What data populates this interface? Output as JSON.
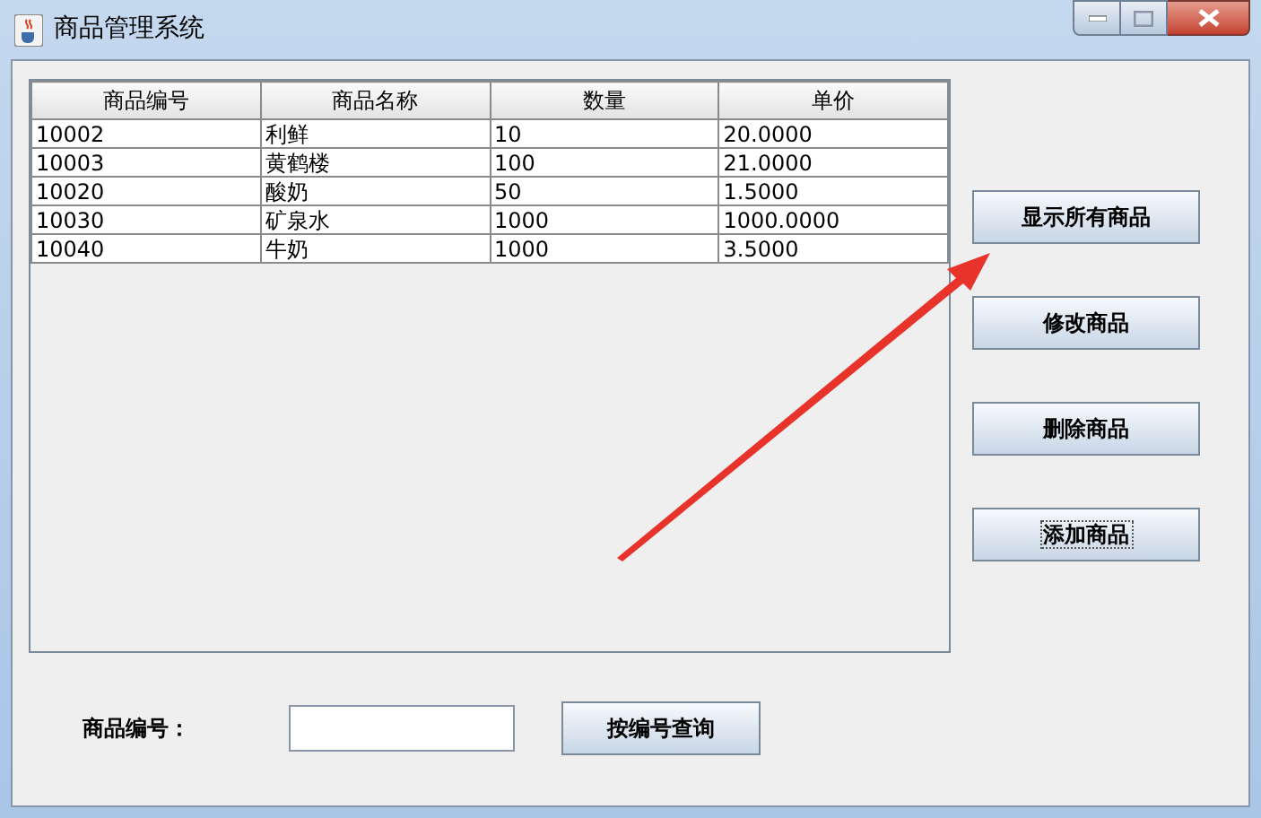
{
  "window": {
    "title": "商品管理系统"
  },
  "table": {
    "columns": [
      "商品编号",
      "商品名称",
      "数量",
      "单价"
    ],
    "rows": [
      [
        "10002",
        "利鲜",
        "10",
        "20.0000"
      ],
      [
        "10003",
        "黄鹤楼",
        "100",
        "21.0000"
      ],
      [
        "10020",
        "酸奶",
        "50",
        "1.5000"
      ],
      [
        "10030",
        "矿泉水",
        "1000",
        "1000.0000"
      ],
      [
        "10040",
        "牛奶",
        "1000",
        "3.5000"
      ]
    ]
  },
  "buttons": [
    {
      "label": "显示所有商品",
      "focused": false
    },
    {
      "label": "修改商品",
      "focused": false
    },
    {
      "label": "删除商品",
      "focused": false
    },
    {
      "label": "添加商品",
      "focused": true
    }
  ],
  "search": {
    "label": "商品编号：",
    "button": "按编号查询"
  }
}
